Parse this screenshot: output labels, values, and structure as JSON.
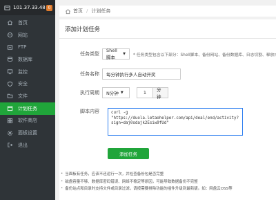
{
  "sidebar": {
    "ip": "101.37.33.48",
    "badge": "0",
    "items": [
      {
        "label": "首页",
        "icon": "home-icon"
      },
      {
        "label": "网站",
        "icon": "globe-icon"
      },
      {
        "label": "FTP",
        "icon": "ftp-icon"
      },
      {
        "label": "数据库",
        "icon": "database-icon"
      },
      {
        "label": "监控",
        "icon": "monitor-icon"
      },
      {
        "label": "安全",
        "icon": "shield-icon"
      },
      {
        "label": "文件",
        "icon": "folder-icon"
      },
      {
        "label": "计划任务",
        "icon": "calendar-icon",
        "active": true
      },
      {
        "label": "软件商店",
        "icon": "store-icon"
      },
      {
        "label": "面板设置",
        "icon": "settings-icon"
      },
      {
        "label": "退出",
        "icon": "logout-icon"
      }
    ]
  },
  "breadcrumb": {
    "home": "首页",
    "sep": "/",
    "current": "计划任务"
  },
  "card": {
    "title": "添加计划任务"
  },
  "form": {
    "task_type_label": "任务类型",
    "task_type_value": "Shell脚本",
    "task_type_hint": "* 任务类型包含以下部分：Shell脚本、备份网站、备份数据库、日志切割、释放内",
    "task_name_label": "任务名称",
    "task_name_value": "每分钟执行多人自动开奖",
    "period_label": "执行周期",
    "period_value": "N分钟",
    "period_number": "1",
    "period_unit": "分钟",
    "script_label": "脚本内容",
    "script_value": "curl -g \"https://duola.letaohelper.com/api/deal/end/activity?sign=daj0sdajk2Esiw9fUd\"",
    "add_button": "添加任务"
  },
  "notes": [
    "当面板有任务，应该不还运行一次，并检查备份包是否完整",
    "磁盘容量不够、数据库密码错误、网络不稳定等原因，可能导致数据备份不完整",
    "备份站点和目录时支持文件或目录过滤，请按需要排除功能的插件升级到最新版。如：网盘云OSS等"
  ],
  "colors": {
    "accent": "#20a53a",
    "sidebar": "#2f3438",
    "focus": "#2e7ff0"
  }
}
